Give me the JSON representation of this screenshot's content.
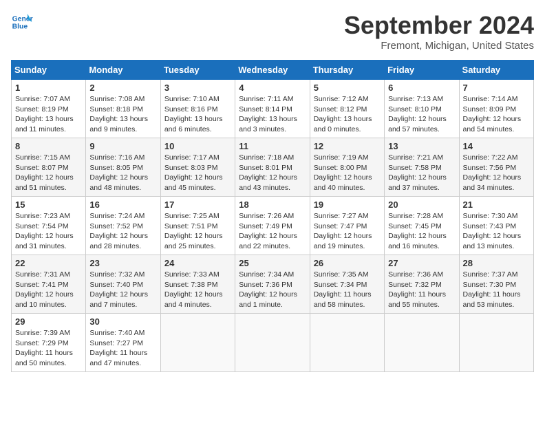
{
  "header": {
    "logo_line1": "General",
    "logo_line2": "Blue",
    "month": "September 2024",
    "location": "Fremont, Michigan, United States"
  },
  "days_of_week": [
    "Sunday",
    "Monday",
    "Tuesday",
    "Wednesday",
    "Thursday",
    "Friday",
    "Saturday"
  ],
  "weeks": [
    [
      {
        "day": "1",
        "info": "Sunrise: 7:07 AM\nSunset: 8:19 PM\nDaylight: 13 hours and 11 minutes."
      },
      {
        "day": "2",
        "info": "Sunrise: 7:08 AM\nSunset: 8:18 PM\nDaylight: 13 hours and 9 minutes."
      },
      {
        "day": "3",
        "info": "Sunrise: 7:10 AM\nSunset: 8:16 PM\nDaylight: 13 hours and 6 minutes."
      },
      {
        "day": "4",
        "info": "Sunrise: 7:11 AM\nSunset: 8:14 PM\nDaylight: 13 hours and 3 minutes."
      },
      {
        "day": "5",
        "info": "Sunrise: 7:12 AM\nSunset: 8:12 PM\nDaylight: 13 hours and 0 minutes."
      },
      {
        "day": "6",
        "info": "Sunrise: 7:13 AM\nSunset: 8:10 PM\nDaylight: 12 hours and 57 minutes."
      },
      {
        "day": "7",
        "info": "Sunrise: 7:14 AM\nSunset: 8:09 PM\nDaylight: 12 hours and 54 minutes."
      }
    ],
    [
      {
        "day": "8",
        "info": "Sunrise: 7:15 AM\nSunset: 8:07 PM\nDaylight: 12 hours and 51 minutes."
      },
      {
        "day": "9",
        "info": "Sunrise: 7:16 AM\nSunset: 8:05 PM\nDaylight: 12 hours and 48 minutes."
      },
      {
        "day": "10",
        "info": "Sunrise: 7:17 AM\nSunset: 8:03 PM\nDaylight: 12 hours and 45 minutes."
      },
      {
        "day": "11",
        "info": "Sunrise: 7:18 AM\nSunset: 8:01 PM\nDaylight: 12 hours and 43 minutes."
      },
      {
        "day": "12",
        "info": "Sunrise: 7:19 AM\nSunset: 8:00 PM\nDaylight: 12 hours and 40 minutes."
      },
      {
        "day": "13",
        "info": "Sunrise: 7:21 AM\nSunset: 7:58 PM\nDaylight: 12 hours and 37 minutes."
      },
      {
        "day": "14",
        "info": "Sunrise: 7:22 AM\nSunset: 7:56 PM\nDaylight: 12 hours and 34 minutes."
      }
    ],
    [
      {
        "day": "15",
        "info": "Sunrise: 7:23 AM\nSunset: 7:54 PM\nDaylight: 12 hours and 31 minutes."
      },
      {
        "day": "16",
        "info": "Sunrise: 7:24 AM\nSunset: 7:52 PM\nDaylight: 12 hours and 28 minutes."
      },
      {
        "day": "17",
        "info": "Sunrise: 7:25 AM\nSunset: 7:51 PM\nDaylight: 12 hours and 25 minutes."
      },
      {
        "day": "18",
        "info": "Sunrise: 7:26 AM\nSunset: 7:49 PM\nDaylight: 12 hours and 22 minutes."
      },
      {
        "day": "19",
        "info": "Sunrise: 7:27 AM\nSunset: 7:47 PM\nDaylight: 12 hours and 19 minutes."
      },
      {
        "day": "20",
        "info": "Sunrise: 7:28 AM\nSunset: 7:45 PM\nDaylight: 12 hours and 16 minutes."
      },
      {
        "day": "21",
        "info": "Sunrise: 7:30 AM\nSunset: 7:43 PM\nDaylight: 12 hours and 13 minutes."
      }
    ],
    [
      {
        "day": "22",
        "info": "Sunrise: 7:31 AM\nSunset: 7:41 PM\nDaylight: 12 hours and 10 minutes."
      },
      {
        "day": "23",
        "info": "Sunrise: 7:32 AM\nSunset: 7:40 PM\nDaylight: 12 hours and 7 minutes."
      },
      {
        "day": "24",
        "info": "Sunrise: 7:33 AM\nSunset: 7:38 PM\nDaylight: 12 hours and 4 minutes."
      },
      {
        "day": "25",
        "info": "Sunrise: 7:34 AM\nSunset: 7:36 PM\nDaylight: 12 hours and 1 minute."
      },
      {
        "day": "26",
        "info": "Sunrise: 7:35 AM\nSunset: 7:34 PM\nDaylight: 11 hours and 58 minutes."
      },
      {
        "day": "27",
        "info": "Sunrise: 7:36 AM\nSunset: 7:32 PM\nDaylight: 11 hours and 55 minutes."
      },
      {
        "day": "28",
        "info": "Sunrise: 7:37 AM\nSunset: 7:30 PM\nDaylight: 11 hours and 53 minutes."
      }
    ],
    [
      {
        "day": "29",
        "info": "Sunrise: 7:39 AM\nSunset: 7:29 PM\nDaylight: 11 hours and 50 minutes."
      },
      {
        "day": "30",
        "info": "Sunrise: 7:40 AM\nSunset: 7:27 PM\nDaylight: 11 hours and 47 minutes."
      },
      {
        "day": "",
        "info": ""
      },
      {
        "day": "",
        "info": ""
      },
      {
        "day": "",
        "info": ""
      },
      {
        "day": "",
        "info": ""
      },
      {
        "day": "",
        "info": ""
      }
    ]
  ]
}
